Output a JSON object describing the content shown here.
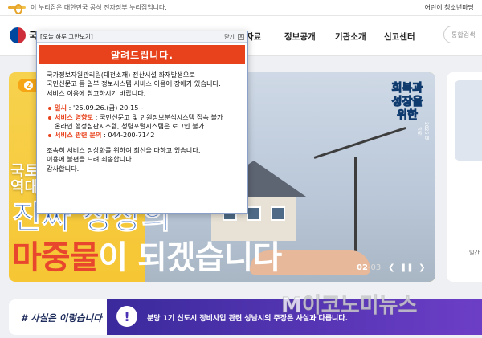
{
  "gov_strip": {
    "text": "이 누리집은 대한민국 공식 전자정부 누리집입니다.",
    "right_link": "어린이 청소년마당"
  },
  "header": {
    "brand": "국",
    "nav": [
      "자료",
      "정보공개",
      "기관소개",
      "신고센터"
    ],
    "search_placeholder": "통합검색"
  },
  "hero": {
    "badge_number": "2",
    "badge_label": "모",
    "line1": "국토",
    "line2": "역대",
    "line3": "진짜 성장의",
    "line4_red": "마중물",
    "line4_rest": "이 되겠습니다",
    "stamp_lines": [
      "회복과",
      "성장을",
      "위한"
    ],
    "stamp_year": "2026 예산안",
    "slide_current": "02",
    "slide_total": "-03"
  },
  "side": {
    "label": "일간"
  },
  "fact": {
    "title": "# 사실은 이렇습니다",
    "icon": "!",
    "text": "분당 1기 신도시 정비사업 관련 성남시의 주장은 사실과 다릅니다."
  },
  "watermark": "M이코노미뉴스",
  "popup": {
    "bar_label": "[오늘 하루 그만보기]",
    "close_label": "닫기",
    "close_glyph": "x",
    "title": "알려드립니다.",
    "intro": [
      "국가정보자원관리원(대전소재) 전산시설 화재발생으로",
      "국민신문고 등 일부 정보시스템 서비스 이용에 장애가 있습니다.",
      "서비스 이용에 참고하시기 바랍니다."
    ],
    "items": [
      {
        "key": "일시",
        "value": " : '25.09.26.(금) 20:15~",
        "cont": ""
      },
      {
        "key": "서비스 영향도",
        "value": " : 국민신문고 및 민원정보분석시스템 접속 불가",
        "cont": "온라인 행정심판시스템, 청렴포털시스템은 로그인 불가"
      },
      {
        "key": "서비스 관련 문의",
        "value": " : 044-200-7142",
        "cont": ""
      }
    ],
    "outro": [
      "조속히 서비스 정상화를 위하여 최선을 다하고 있습니다.",
      "이용에 불편을 드려 죄송합니다.",
      "감사합니다."
    ]
  }
}
